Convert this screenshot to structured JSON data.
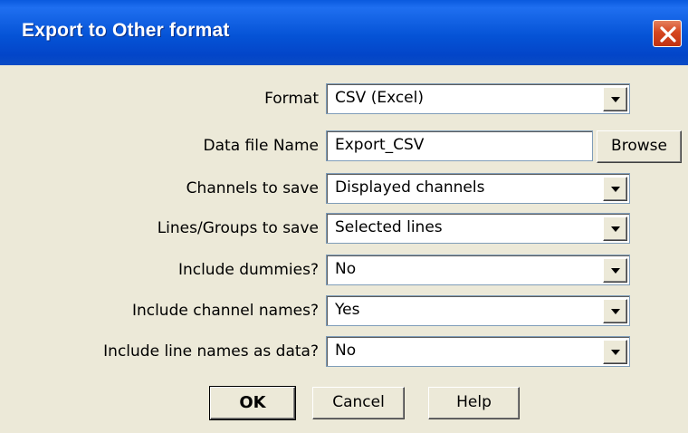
{
  "window": {
    "title": "Export to Other format"
  },
  "form": {
    "format": {
      "label": "Format",
      "value": "CSV  (Excel)"
    },
    "data_file": {
      "label": "Data file Name",
      "value": "Export_CSV",
      "browse_label": "Browse"
    },
    "channels": {
      "label": "Channels to save",
      "value": "Displayed channels"
    },
    "lines": {
      "label": "Lines/Groups to save",
      "value": "Selected lines"
    },
    "dummies": {
      "label": "Include dummies?",
      "value": "No"
    },
    "channel_names": {
      "label": "Include channel names?",
      "value": "Yes"
    },
    "line_names": {
      "label": "Include line names as data?",
      "value": "No"
    }
  },
  "buttons": {
    "ok": "OK",
    "cancel": "Cancel",
    "help": "Help"
  },
  "icons": {
    "close": "close-icon",
    "dropdown": "chevron-down-icon"
  },
  "colors": {
    "titlebar": "#0553d6",
    "close": "#d54620",
    "face": "#ece9d8"
  }
}
